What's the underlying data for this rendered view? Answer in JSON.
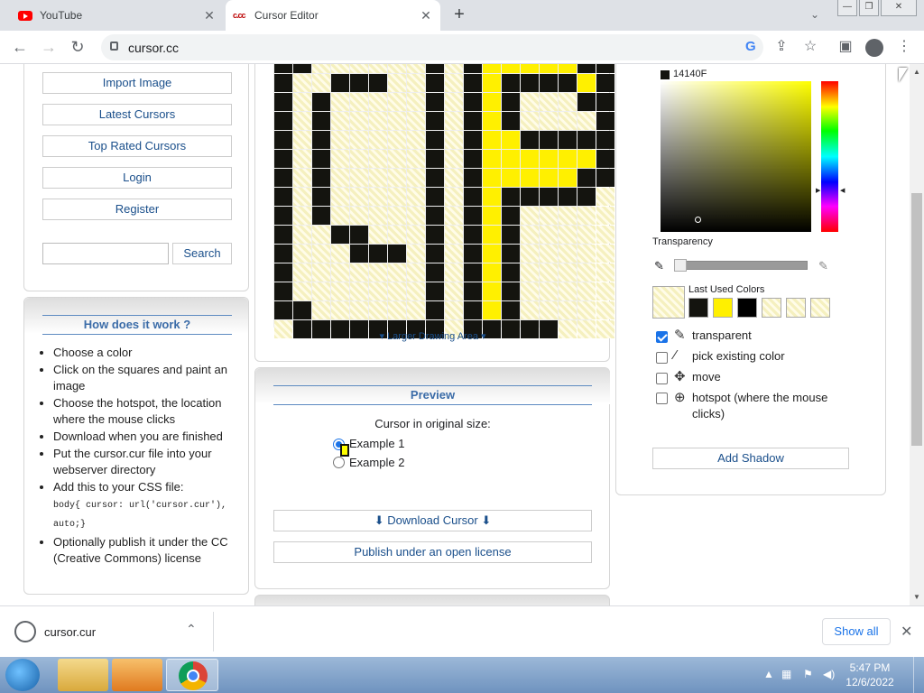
{
  "browser": {
    "tabs": [
      {
        "title": "YouTube",
        "close": "✕"
      },
      {
        "title": "Cursor Editor",
        "close": "✕"
      }
    ],
    "new_tab": "+",
    "url": "cursor.cc",
    "window_controls": [
      "—",
      "❐",
      "✕"
    ]
  },
  "left_panel": {
    "buttons": [
      "Import Image",
      "Latest Cursors",
      "Top Rated Cursors",
      "Login",
      "Register"
    ],
    "search_placeholder": "",
    "search_button": "Search"
  },
  "how_it_works": {
    "title": "How does it work ?",
    "steps": [
      "Choose a color",
      "Click on the squares and paint an image",
      "Choose the hotspot, the location where the mouse clicks",
      "Download when you are finished",
      "Put the cursor.cur file into your webserver directory",
      "Add this to your CSS file:",
      "Optionally publish it under the CC (Creative Commons) license"
    ],
    "css_code": "body{ cursor: url('cursor.cur'), auto;}"
  },
  "editor": {
    "larger_label": "▾ Larger Drawing Area ▾",
    "grid_rows": [
      "BBxxxxxxBxBYYYYYBB",
      "BxxBBBxxBxBYBBBBYB",
      "BxBxxxxxBxBYBxxxBB",
      "BxBxxxxxBxBYBxxxxB",
      "BxBxxxxxBxBYYBBBBB",
      "BxBxxxxxBxBYYYYYYB",
      "BxBxxxxxBxBYYYYYBB",
      "BxBxxxxxBxBYBBBBBx",
      "BxBxxxxxBxBYBxxxxx",
      "BxxBBxxxBxBYBxxxxx",
      "BxxxBBBxBxBYBxxxxx",
      "BxxxxxxxBxBYBxxxxx",
      "BxxxxxxxBxBYBxxxxx",
      "BBxxxxxxBxBYBxxxxx",
      "xBBBBBBBBxBBBBBxxx"
    ],
    "colors": {
      "B": "#14140F",
      "Y": "#FFF000",
      "x": "checker"
    }
  },
  "preview": {
    "title": "Preview",
    "original_size_label": "Cursor in original size:",
    "examples": [
      "Example 1",
      "Example 2"
    ],
    "selected_example": 0,
    "download_button": "⬇ Download Cursor ⬇",
    "publish_button": "Publish under an open license"
  },
  "color_panel": {
    "current_color": "14140F",
    "current_color_hex": "#14140F",
    "transparency_label": "Transparency",
    "last_used_label": "Last Used Colors",
    "last_used_colors": [
      "#14140F",
      "#FFF000",
      "#000000",
      "checker",
      "checker",
      "checker"
    ],
    "options": [
      {
        "label": "transparent",
        "checked": true,
        "icon": "eraser-icon"
      },
      {
        "label": "pick existing color",
        "checked": false,
        "icon": "eyedropper-icon"
      },
      {
        "label": "move",
        "checked": false,
        "icon": "move-icon"
      },
      {
        "label": "hotspot (where the mouse clicks)",
        "checked": false,
        "icon": "crosshair-icon"
      }
    ],
    "add_shadow_button": "Add Shadow"
  },
  "downloads": {
    "file_name": "cursor.cur",
    "show_all": "Show all"
  },
  "taskbar": {
    "time": "5:47 PM",
    "date": "12/6/2022"
  }
}
